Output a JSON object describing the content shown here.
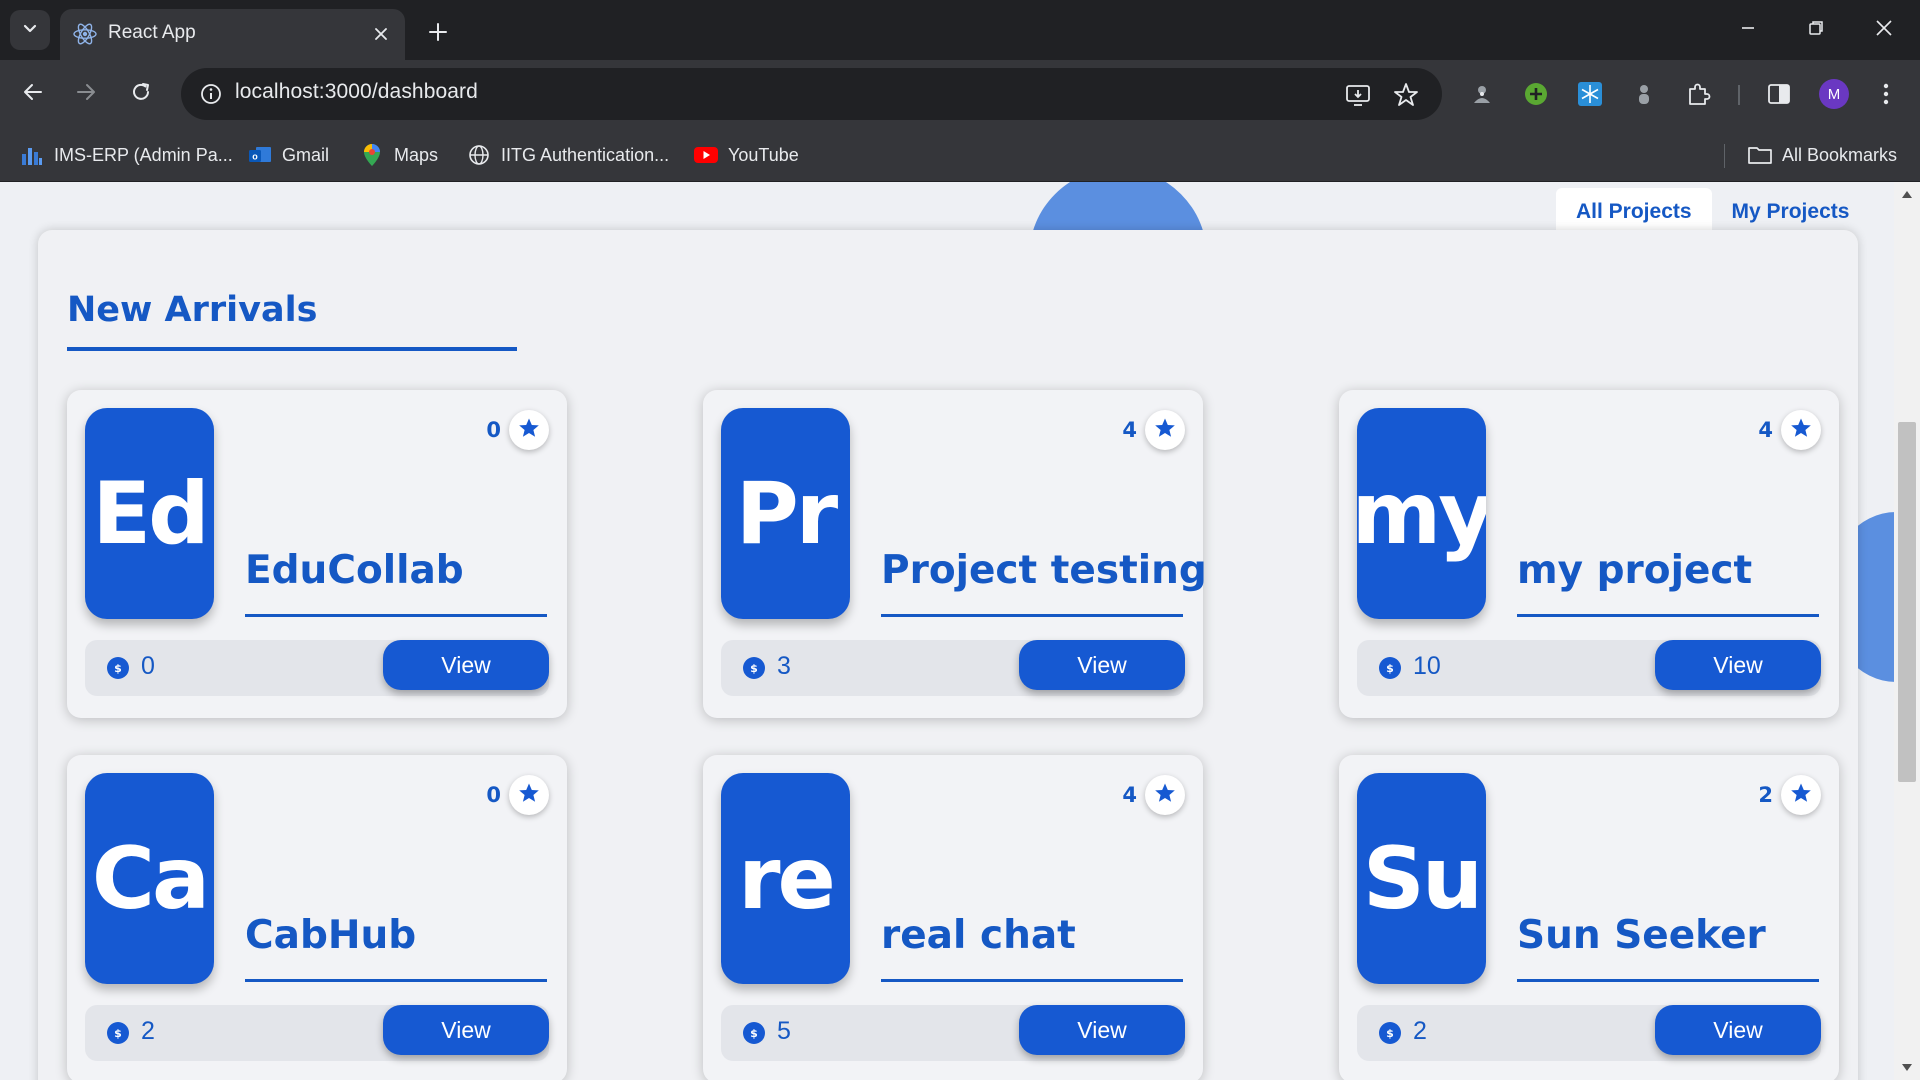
{
  "browser": {
    "tab_title": "React App",
    "url": "localhost:3000/dashboard",
    "profile_initial": "M",
    "bookmarks": [
      {
        "label": "IMS-ERP (Admin Pa...",
        "icon": "bar-chart-icon"
      },
      {
        "label": "Gmail",
        "icon": "outlook-icon"
      },
      {
        "label": "Maps",
        "icon": "maps-pin-icon"
      },
      {
        "label": "IITG Authentication...",
        "icon": "globe-icon"
      },
      {
        "label": "YouTube",
        "icon": "youtube-icon"
      }
    ],
    "all_bookmarks_label": "All Bookmarks"
  },
  "page": {
    "tabs": [
      {
        "label": "All Projects",
        "active": true
      },
      {
        "label": "My Projects",
        "active": false
      }
    ],
    "section_title": "New Arrivals",
    "projects": [
      {
        "initials": "Ed",
        "name": "EduCollab",
        "stars": "0",
        "coins": "0",
        "action": "View"
      },
      {
        "initials": "Pr",
        "name": "Project testing",
        "stars": "4",
        "coins": "3",
        "action": "View"
      },
      {
        "initials": "my",
        "name": "my project",
        "stars": "4",
        "coins": "10",
        "action": "View"
      },
      {
        "initials": "Ca",
        "name": "CabHub",
        "stars": "0",
        "coins": "2",
        "action": "View"
      },
      {
        "initials": "re",
        "name": "real chat",
        "stars": "4",
        "coins": "5",
        "action": "View"
      },
      {
        "initials": "Su",
        "name": "Sun Seeker",
        "stars": "2",
        "coins": "2",
        "action": "View"
      }
    ],
    "coin_symbol": "$"
  },
  "colors": {
    "accent": "#1558c4",
    "card_blue": "#1659d2",
    "blob": "#5b8fe0",
    "page_bg": "#eef0f4"
  }
}
